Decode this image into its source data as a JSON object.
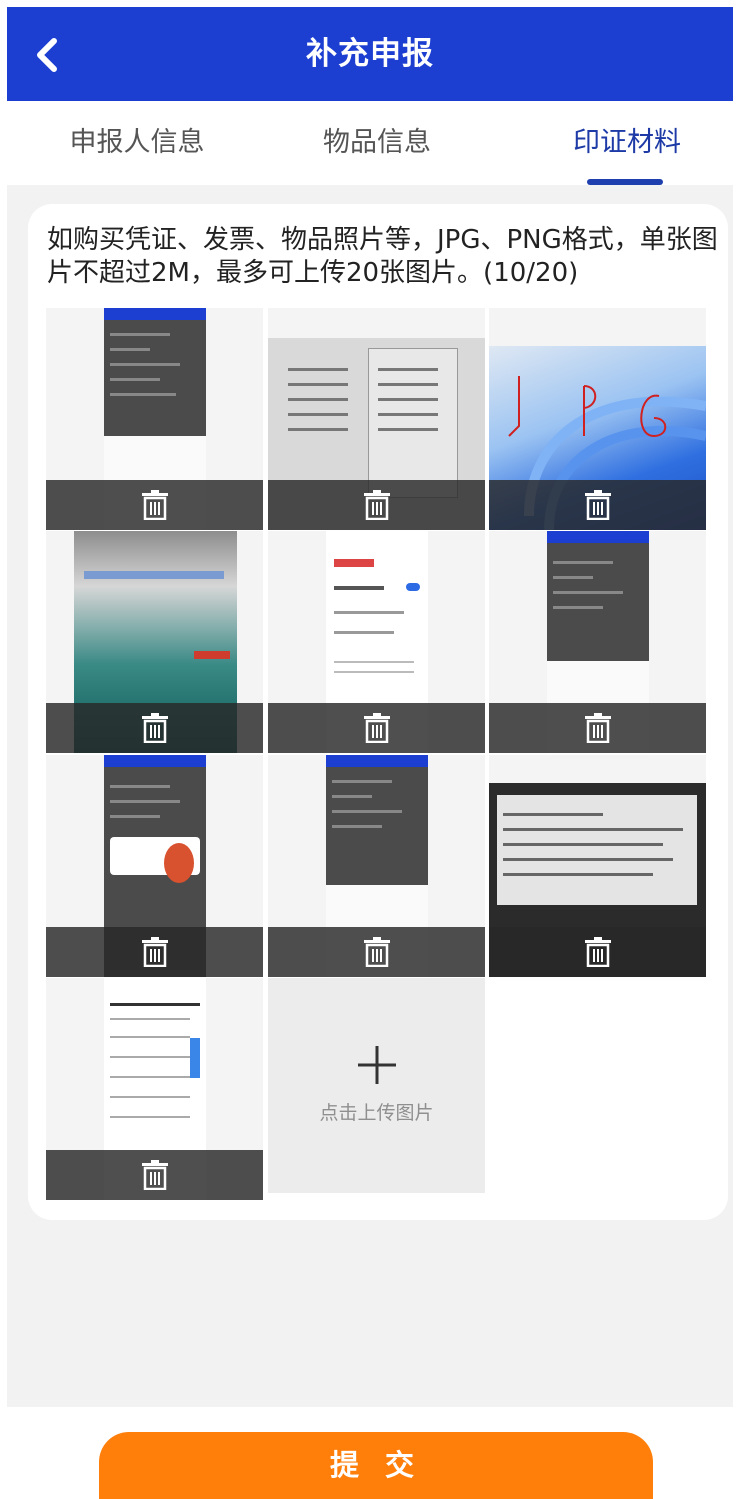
{
  "header": {
    "title": "补充申报"
  },
  "tabs": [
    {
      "label": "申报人信息",
      "active": false
    },
    {
      "label": "物品信息",
      "active": false
    },
    {
      "label": "印证材料",
      "active": true
    }
  ],
  "card": {
    "description": "如购买凭证、发票、物品照片等，JPG、PNG格式，单张图片不超过2M，最多可上传20张图片。(10/20)"
  },
  "images": [
    {
      "id": 1,
      "kind": "app-screenshot"
    },
    {
      "id": 2,
      "kind": "paper-photo"
    },
    {
      "id": 3,
      "kind": "wallpaper-photo"
    },
    {
      "id": 4,
      "kind": "monitor-photo"
    },
    {
      "id": 5,
      "kind": "app-screenshot"
    },
    {
      "id": 6,
      "kind": "app-screenshot"
    },
    {
      "id": 7,
      "kind": "app-screenshot"
    },
    {
      "id": 8,
      "kind": "app-screenshot"
    },
    {
      "id": 9,
      "kind": "monitor-photo"
    },
    {
      "id": 10,
      "kind": "app-screenshot"
    }
  ],
  "upload": {
    "label": "点击上传图片"
  },
  "submit": {
    "label": "提 交"
  },
  "colors": {
    "header": "#1c3fd1",
    "tab_active": "#1d3aa6",
    "submit": "#ff7f0a"
  },
  "icons": {
    "back": "chevron-left-icon",
    "delete": "trash-icon",
    "add": "plus-icon"
  }
}
